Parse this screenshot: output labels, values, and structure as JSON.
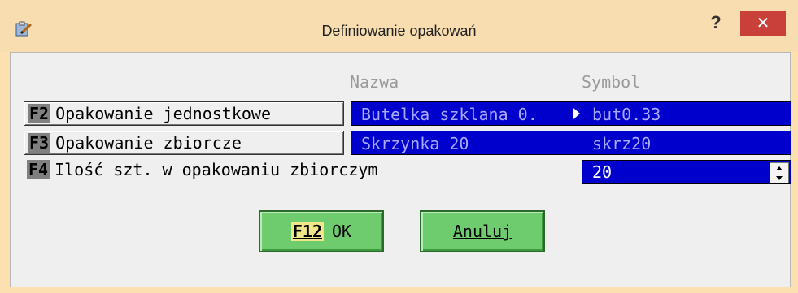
{
  "window": {
    "title": "Definiowanie opakowań",
    "help_label": "?",
    "close_label": "✕",
    "app_icon": "clipboard-pencil-icon"
  },
  "headers": {
    "name": "Nazwa",
    "symbol": "Symbol"
  },
  "rows": [
    {
      "key": "F2",
      "label": "Opakowanie jednostkowe",
      "name": "Butelka szklana 0.",
      "symbol": "but0.33"
    },
    {
      "key": "F3",
      "label": "Opakowanie zbiorcze",
      "name": "Skrzynka 20",
      "symbol": "skrz20"
    }
  ],
  "quantity": {
    "key": "F4",
    "label": "Ilość szt. w opakowaniu zbiorczym",
    "value": "20"
  },
  "buttons": {
    "ok_key": "F12",
    "ok_label": "OK",
    "cancel_label": "Anuluj"
  },
  "colors": {
    "titlebar": "#f8ddb0",
    "field_bg": "#0000cc",
    "field_text": "#a9a9ff",
    "button_green": "#6ecc6e",
    "close_red": "#c9403a"
  }
}
